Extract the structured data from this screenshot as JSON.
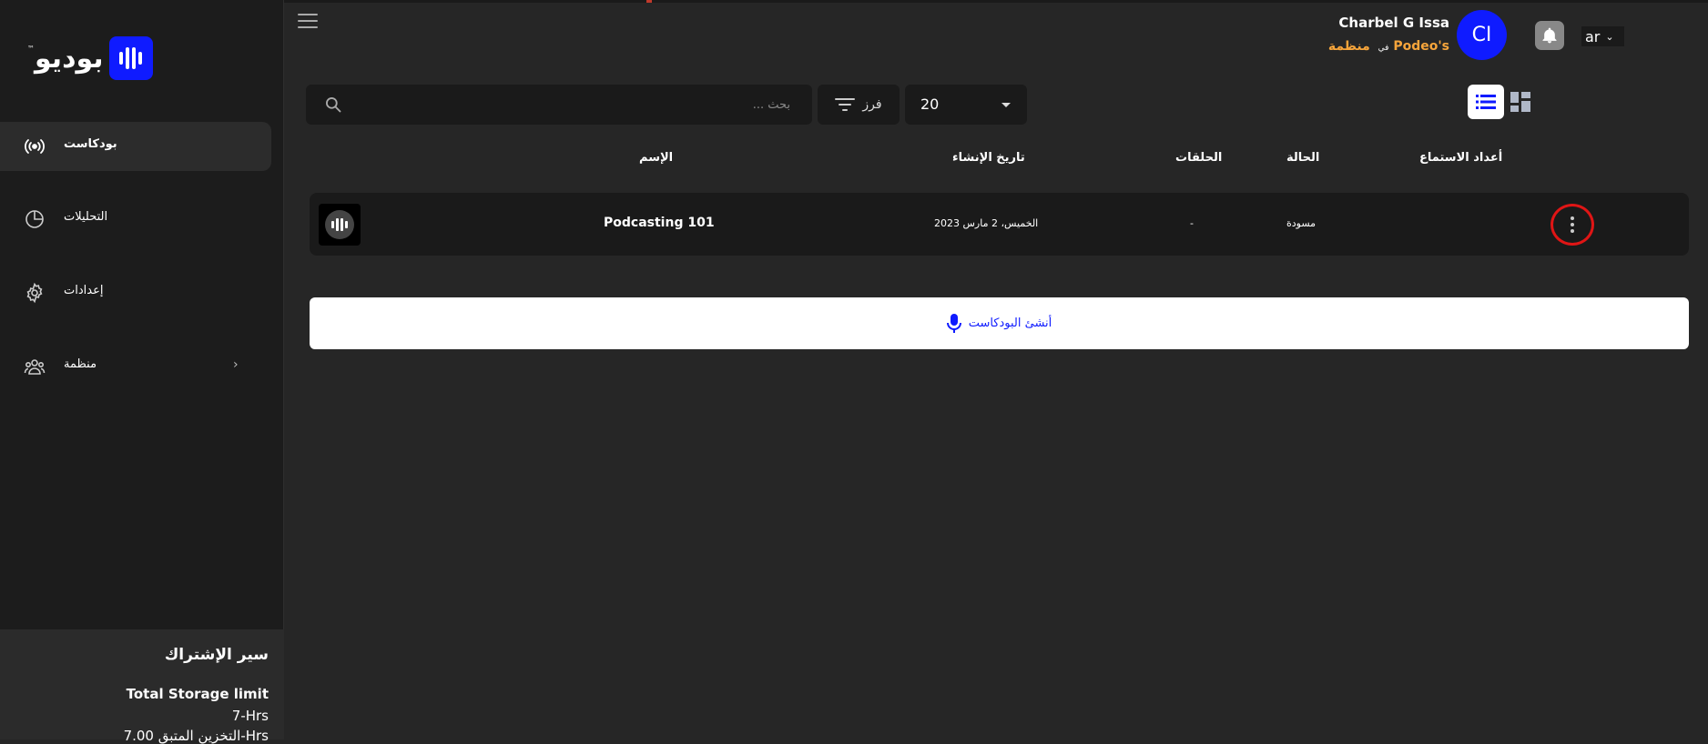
{
  "sidebar": {
    "logo_text": "بوديو",
    "logo_tm": "™",
    "nav": [
      {
        "label": "بودكاست",
        "icon": "broadcast-icon",
        "active": true
      },
      {
        "label": "التحليلات",
        "icon": "pie-chart-icon"
      },
      {
        "label": "إعدادات",
        "icon": "gear-icon"
      },
      {
        "label": "منظمة",
        "icon": "users-icon"
      }
    ],
    "subscription": {
      "title": "سير الإشتراك",
      "storage_label": "Total Storage limit",
      "storage_value": "7-Hrs",
      "remaining": "التخزين المتبق 7.00-Hrs"
    }
  },
  "header": {
    "user_name": "Charbel G Issa",
    "org_name": "منظمة Podeo's",
    "org_prefix": "في",
    "avatar_initials": "CI",
    "language": "ar"
  },
  "toolbar": {
    "search_placeholder": "بحث ...",
    "sort_label": "فرز",
    "per_page": "20"
  },
  "table": {
    "headers": {
      "name": "الإسم",
      "created": "تاريخ الإنشاء",
      "episodes": "الحلقات",
      "status": "الحالة",
      "listens": "أعداد الاستماع"
    },
    "rows": [
      {
        "name": "Podcasting 101",
        "created": "الخميس، 2 مارس 2023",
        "episodes": "-",
        "status": "مسودة",
        "listens": ""
      }
    ]
  },
  "create_button": {
    "label": "أنشئ البودكاست"
  },
  "colors": {
    "accent": "#0f1bff",
    "org_highlight": "#f7a53b",
    "annotation": "#e01515"
  }
}
